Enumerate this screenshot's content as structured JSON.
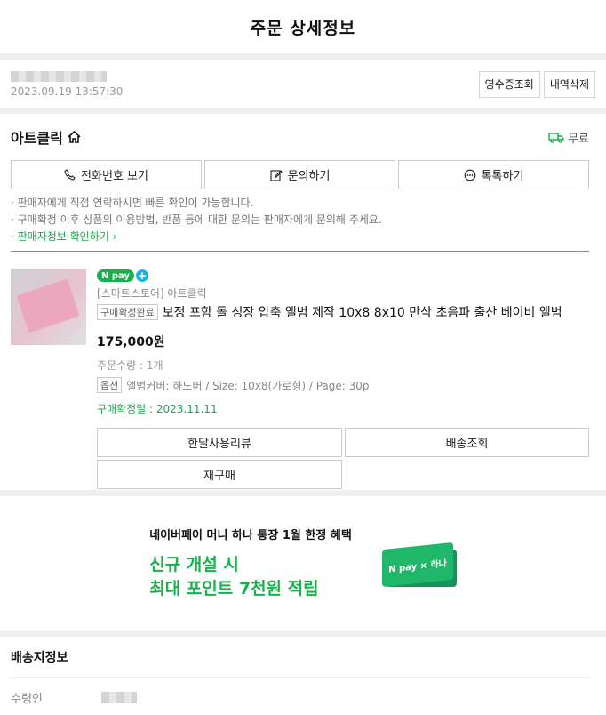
{
  "header": {
    "title": "주문 상세정보"
  },
  "order": {
    "datetime": "2023.09.19 13:57:30",
    "receipt_label": "영수증조회",
    "delete_label": "내역삭제"
  },
  "store": {
    "name": "아트클릭",
    "delivery_fee": "무료",
    "actions": [
      {
        "label": "전화번호 보기",
        "icon": "phone-icon"
      },
      {
        "label": "문의하기",
        "icon": "edit-icon"
      },
      {
        "label": "톡톡하기",
        "icon": "chat-icon"
      }
    ],
    "notes": [
      "· 판매자에게 직접 연락하시면 빠른 확인이 가능합니다.",
      "· 구매확정 이후 상품의 이용방법, 반품 등에 대한 문의는 판매자에게 문의해 주세요."
    ],
    "seller_info_link": "· 판매자정보 확인하기"
  },
  "item": {
    "npay_badge": "pay",
    "seller_line": "[스마트스토어] 아트클릭",
    "status_tag": "구매확정완료",
    "title": "보정 포함 돌 성장 압축 앨범 제작 10x8 8x10 만삭 초음파 출산 베이비 앨범",
    "price": "175,000원",
    "quantity": "주문수량 : 1개",
    "option_tag": "옵션",
    "option_value": "앨범커버: 하노버 / Size: 10x8(가로형) / Page: 30p",
    "confirm_date": "구매확정일 : 2023.11.11",
    "buttons": [
      "한달사용리뷰",
      "배송조회",
      "재구매"
    ]
  },
  "banner": {
    "headline": "네이버페이 머니 하나 통장 1월 한정 혜택",
    "line1": "신규 개설 시",
    "line2": "최대 포인트 7천원 적립",
    "card_text": "N pay × 하나"
  },
  "shipping": {
    "title": "배송지정보",
    "recipient_label": "수령인"
  },
  "colors": {
    "accent": "#19b14b",
    "link": "#19a84a"
  }
}
